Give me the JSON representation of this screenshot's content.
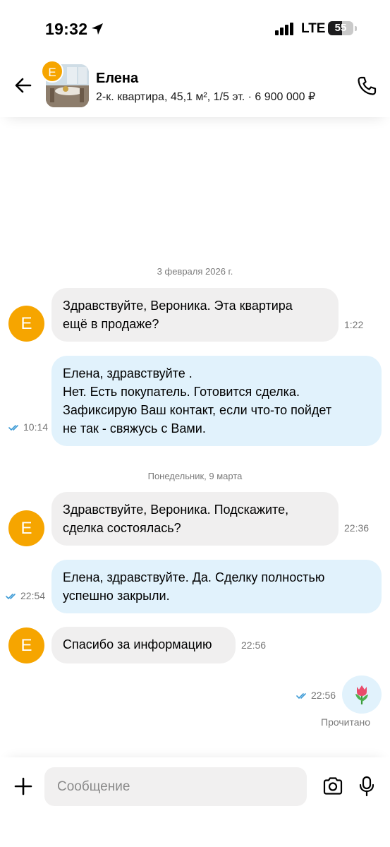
{
  "status_bar": {
    "time": "19:32",
    "network": "LTE",
    "battery": "55"
  },
  "header": {
    "avatar_letter": "E",
    "contact_name": "Елена",
    "listing": "2-к. квартира, 45,1 м², 1/5 эт. · 6 900 000 ₽"
  },
  "chat": {
    "date_1": "3 февраля 2026 г.",
    "date_2": "Понедельник, 9 марта",
    "messages": [
      {
        "avatar": "E",
        "text": "Здравствуйте, Вероника. Эта квартира\nещё в продаже?",
        "time": "1:22"
      },
      {
        "text": "Елена, здравствуйте .\nНет. Есть покупатель. Готовится сделка.\nЗафиксирую Ваш контакт, если что-то пойдет\nне так - свяжусь с Вами.",
        "time": "10:14"
      },
      {
        "avatar": "E",
        "text": "Здравствуйте, Вероника. Подскажите,\nсделка состоялась?",
        "time": "22:36"
      },
      {
        "text": "Елена, здравствуйте. Да. Сделку полностью\nуспешно закрыли.",
        "time": "22:54"
      },
      {
        "avatar": "E",
        "text": "Спасибо за информацию",
        "time": "22:56"
      },
      {
        "emoji": "🌷",
        "time": "22:56"
      }
    ],
    "read_status": "Прочитано"
  },
  "composer": {
    "placeholder": "Сообщение"
  },
  "colors": {
    "avatar": "#f6a500",
    "incoming": "#f0efef",
    "outgoing": "#e1f2fc",
    "tick": "#3d9bd6"
  }
}
